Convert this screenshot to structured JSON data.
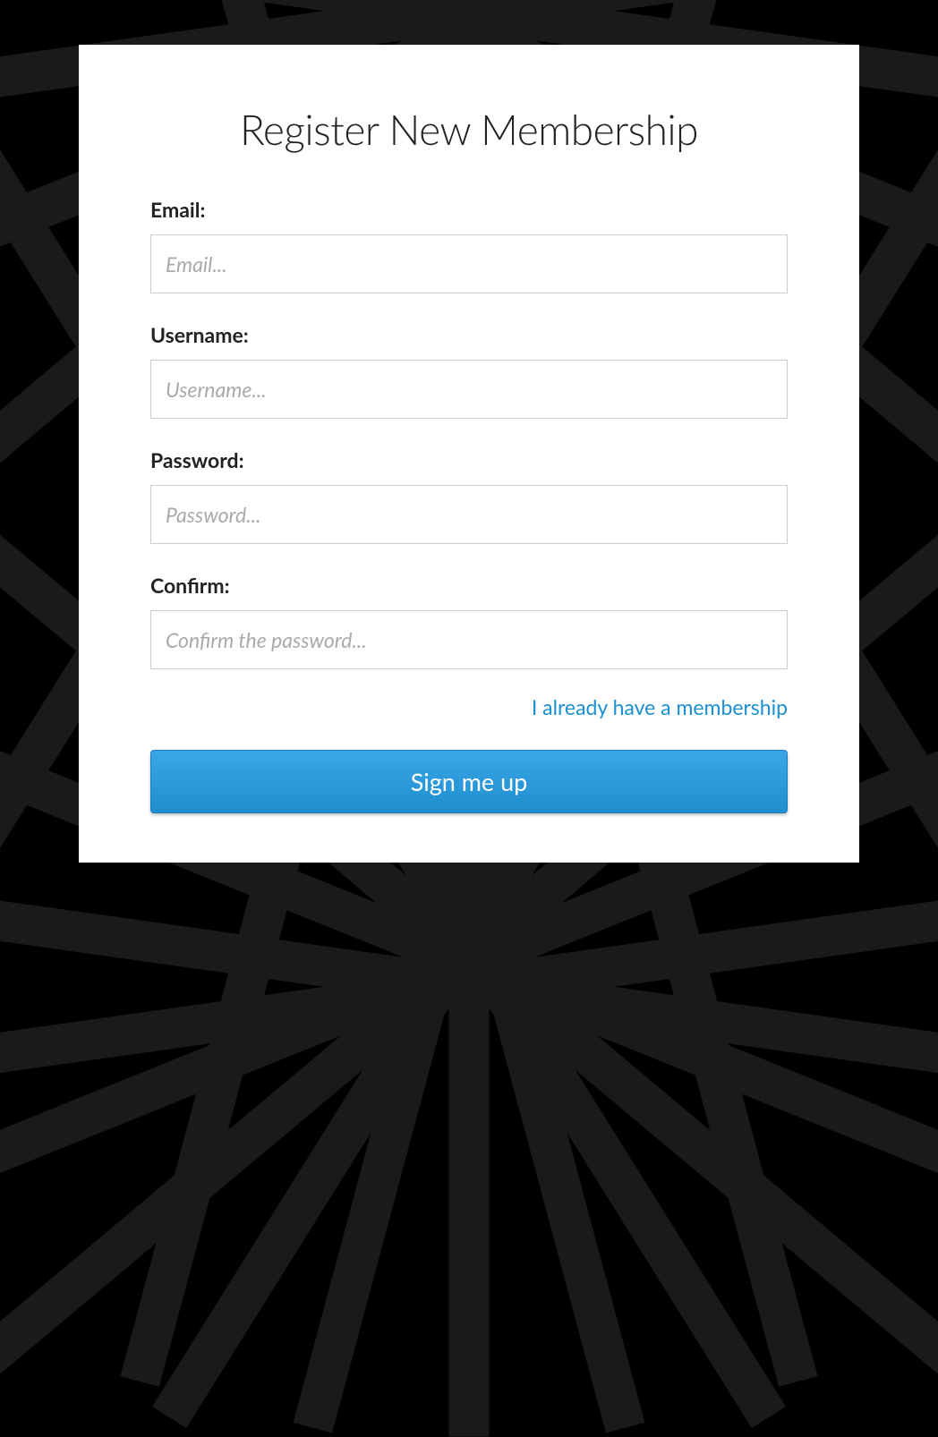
{
  "header": {
    "title": "Register New Membership"
  },
  "fields": {
    "email": {
      "label": "Email:",
      "placeholder": "Email..."
    },
    "username": {
      "label": "Username:",
      "placeholder": "Username..."
    },
    "password": {
      "label": "Password:",
      "placeholder": "Password..."
    },
    "confirm": {
      "label": "Confirm:",
      "placeholder": "Confirm the password..."
    }
  },
  "links": {
    "existing_membership": "I already have a membership"
  },
  "buttons": {
    "submit": "Sign me up"
  }
}
